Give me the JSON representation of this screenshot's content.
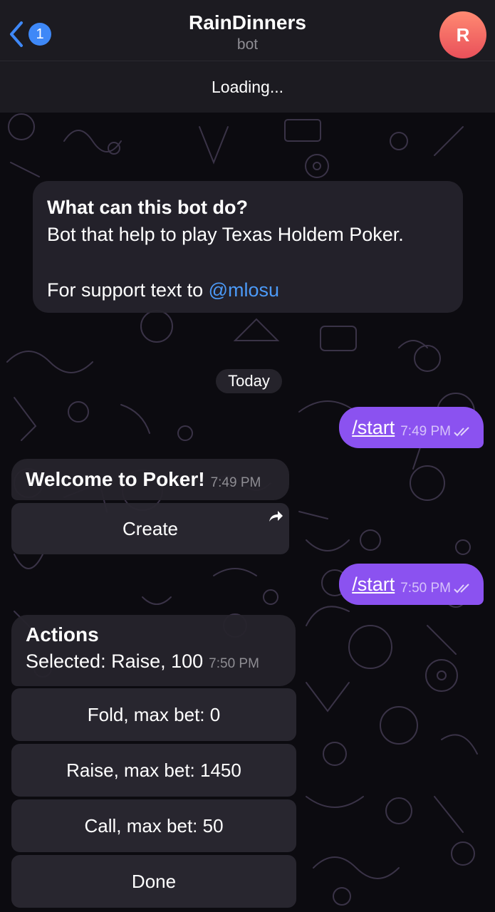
{
  "header": {
    "back_badge": "1",
    "title": "RainDinners",
    "subtitle": "bot",
    "avatar_initial": "R",
    "status": "Loading..."
  },
  "info_card": {
    "title": "What can this bot do?",
    "description": "Bot that help to play Texas Holdem Poker.",
    "support_prefix": "For support text to ",
    "support_mention": "@mlosu"
  },
  "date_separator": "Today",
  "messages": [
    {
      "text": "/start",
      "time": "7:49 PM"
    },
    {
      "text": "Welcome to Poker!",
      "time": "7:49 PM",
      "button": "Create"
    },
    {
      "text": "/start",
      "time": "7:50 PM"
    },
    {
      "title": "Actions",
      "text": "Selected: Raise, 100",
      "time": "7:50 PM",
      "buttons": [
        "Fold, max bet: 0",
        "Raise, max bet: 1450",
        "Call, max bet: 50",
        "Done"
      ]
    }
  ],
  "colors": {
    "accent": "#3e88f7",
    "outgoing_bubble": "#8b52f0",
    "mention": "#4c9af7"
  },
  "icons": [
    "chevron-left-icon",
    "share-icon",
    "double-check-icon"
  ]
}
